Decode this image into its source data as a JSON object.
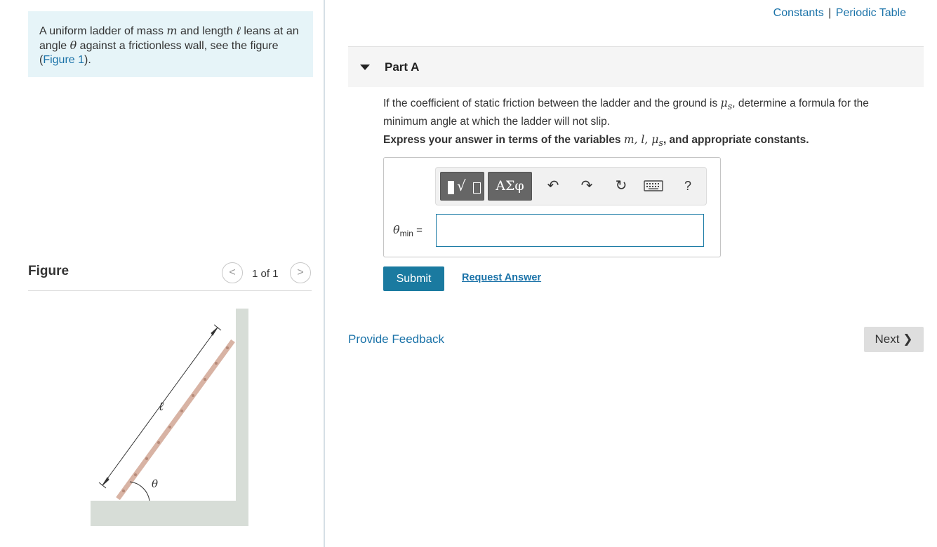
{
  "intro": {
    "text_1": "A uniform ladder of mass ",
    "var_m": "m",
    "text_2": " and length ",
    "var_l": "ℓ",
    "text_3": " leans at an angle ",
    "var_theta": "θ",
    "text_4": " against a frictionless wall, see the figure ",
    "paren_open": "(",
    "figure_link": "Figure 1",
    "paren_close": ")."
  },
  "figure": {
    "title": "Figure",
    "pager_count": "1 of 1",
    "prev_symbol": "<",
    "next_symbol": ">",
    "label_length": "ℓ",
    "label_angle": "θ",
    "colors": {
      "wall": "#d7ddd7",
      "ladder": "#d8b3a4",
      "ladder_dots": "#b68a78",
      "lines": "#333333"
    }
  },
  "header_links": {
    "constants": "Constants",
    "separator": "|",
    "periodic_table": "Periodic Table"
  },
  "part": {
    "title": "Part A",
    "question_1": "If the coefficient of static friction between the ladder and the ground is ",
    "var_mu": "μ",
    "var_mu_sub": "s",
    "question_2": ", determine a formula for the minimum angle at which the ladder will not slip.",
    "instruction_1": "Express your answer in terms of the variables ",
    "instr_vars": "m, l, μ",
    "instr_vars_sub": "s",
    "instruction_2": ", and appropriate constants."
  },
  "toolbar": {
    "template_icon": "template-icon",
    "template_radical": "√",
    "greek_label": "ΑΣφ",
    "undo_icon": "↶",
    "redo_icon": "↷",
    "reset_icon": "↻",
    "help_label": "?"
  },
  "answer": {
    "label_var": "θ",
    "label_sub": "min",
    "label_eq": " =",
    "value": ""
  },
  "actions": {
    "submit": "Submit",
    "request_answer": "Request Answer",
    "provide_feedback": "Provide Feedback",
    "next": "Next",
    "next_chevron": "❯"
  },
  "colors": {
    "link": "#1a72a8",
    "submit_bg": "#1a7aa0",
    "intro_bg": "#e6f4f8",
    "input_border": "#1e7ca6"
  }
}
